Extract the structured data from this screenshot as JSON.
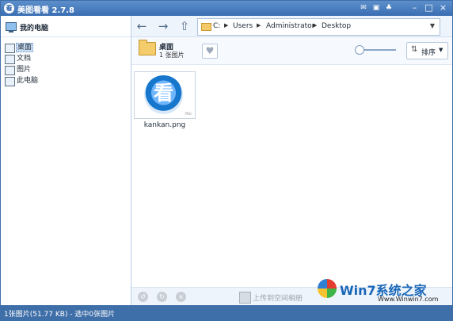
{
  "window": {
    "logo_char": "看",
    "title": "美图看看 2.7.8",
    "toolbar_icons": [
      "message-icon",
      "skin-icon",
      "tshirt-icon"
    ],
    "controls": [
      "minimize",
      "maximize",
      "close"
    ]
  },
  "sidebar": {
    "title": "我的电脑",
    "items": [
      {
        "label": "桌面",
        "icon": "desktop-icon",
        "selected": true
      },
      {
        "label": "文档",
        "icon": "document-icon",
        "selected": false
      },
      {
        "label": "图片",
        "icon": "picture-icon",
        "selected": false
      },
      {
        "label": "此电脑",
        "icon": "computer-icon",
        "selected": false
      }
    ]
  },
  "nav": {
    "back": "back-arrow-icon",
    "forward": "forward-arrow-icon",
    "up": "up-arrow-icon"
  },
  "path": {
    "segments": [
      "C:",
      "Users",
      "Administrator",
      "Desktop"
    ],
    "dropdown": "chevron-down-icon"
  },
  "folder": {
    "name": "桌面",
    "count": "1 张图片",
    "favorite_icon": "heart-icon"
  },
  "zoom": {
    "level": 0
  },
  "sort": {
    "label": "排序"
  },
  "files": [
    {
      "name": "kankan.png",
      "thumbnail_char": "看",
      "tag": "PNG",
      "icon": "kankan-icon"
    }
  ],
  "actions": {
    "upload_label": "上传到空间相册"
  },
  "status": {
    "text": "1张图片(51.77 KB) - 选中0张图片"
  },
  "watermark": {
    "text": "Win7系统之家",
    "url": "Www.Winwin7.com"
  }
}
